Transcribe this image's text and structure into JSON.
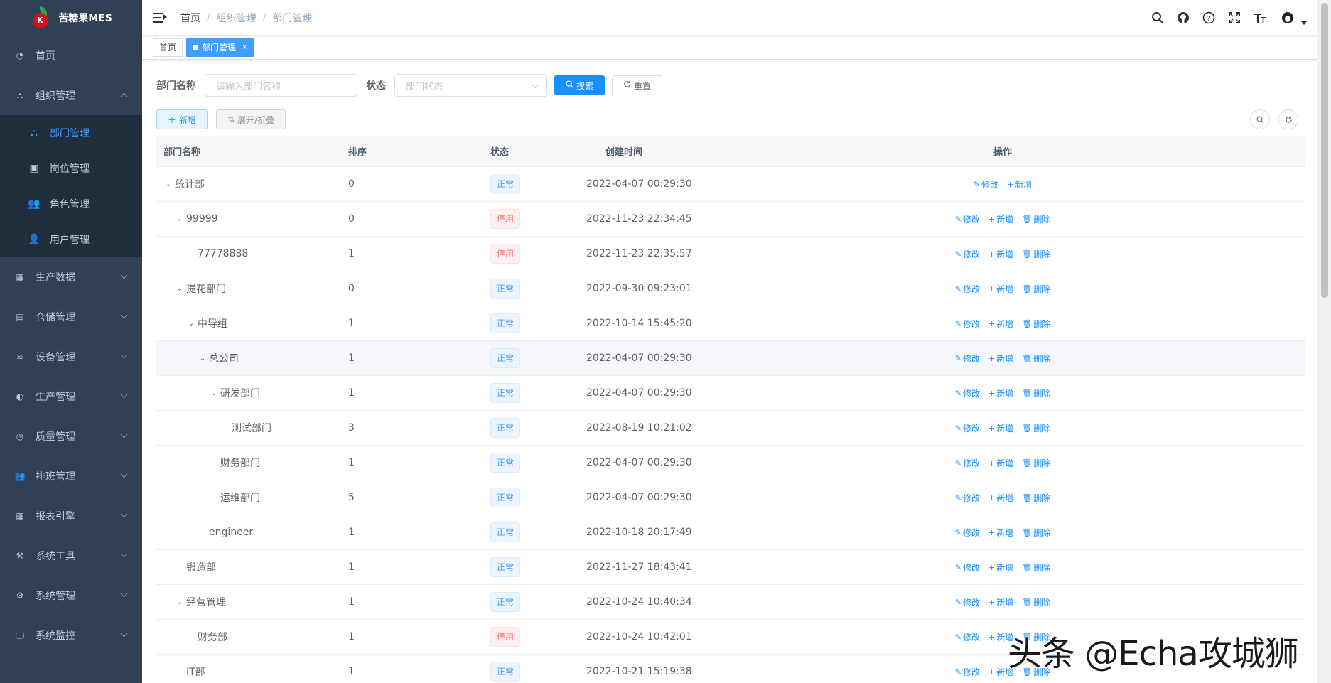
{
  "app": {
    "title": "苦糖果MES"
  },
  "sidebar": {
    "top_items": [
      {
        "label": "首页",
        "icon": "dashboard-icon"
      },
      {
        "label": "组织管理",
        "icon": "tree-icon",
        "expanded": true
      }
    ],
    "sub_items": [
      {
        "label": "部门管理",
        "icon": "tree-icon",
        "active": true
      },
      {
        "label": "岗位管理",
        "icon": "post-icon"
      },
      {
        "label": "角色管理",
        "icon": "peoples-icon"
      },
      {
        "label": "用户管理",
        "icon": "user-icon"
      }
    ],
    "bottom_items": [
      {
        "label": "生产数据",
        "icon": "table-icon"
      },
      {
        "label": "仓储管理",
        "icon": "storage-icon"
      },
      {
        "label": "设备管理",
        "icon": "layers-icon"
      },
      {
        "label": "生产管理",
        "icon": "toggle-icon"
      },
      {
        "label": "质量管理",
        "icon": "time-icon"
      },
      {
        "label": "排班管理",
        "icon": "peoples-icon"
      },
      {
        "label": "报表引擎",
        "icon": "grid-icon"
      },
      {
        "label": "系统工具",
        "icon": "tool-icon"
      },
      {
        "label": "系统管理",
        "icon": "gear-icon"
      },
      {
        "label": "系统监控",
        "icon": "monitor-icon"
      }
    ]
  },
  "navbar": {
    "breadcrumb": [
      "首页",
      "组织管理",
      "部门管理"
    ]
  },
  "tags": {
    "home": "首页",
    "active": "部门管理",
    "close": "×"
  },
  "search": {
    "name_label": "部门名称",
    "name_placeholder": "请输入部门名称",
    "status_label": "状态",
    "status_placeholder": "部门状态",
    "search_btn": "搜索",
    "reset_btn": "重置"
  },
  "toolbar": {
    "add_btn": "新增",
    "expand_btn": "展开/折叠"
  },
  "table": {
    "headers": [
      "部门名称",
      "排序",
      "状态",
      "创建时间",
      "操作"
    ],
    "op_edit": "修改",
    "op_add": "新增",
    "op_delete": "删除",
    "rows": [
      {
        "name": "统计部",
        "level": 0,
        "toggle": true,
        "sort": "0",
        "status": "正常",
        "status_type": "normal",
        "time": "2022-04-07 00:29:30",
        "delete": false
      },
      {
        "name": "99999",
        "level": 1,
        "toggle": true,
        "sort": "0",
        "status": "停用",
        "status_type": "danger",
        "time": "2022-11-23 22:34:45",
        "delete": true
      },
      {
        "name": "77778888",
        "level": 2,
        "toggle": false,
        "sort": "1",
        "status": "停用",
        "status_type": "danger",
        "time": "2022-11-23 22:35:57",
        "delete": true
      },
      {
        "name": "提花部门",
        "level": 1,
        "toggle": true,
        "sort": "0",
        "status": "正常",
        "status_type": "normal",
        "time": "2022-09-30 09:23:01",
        "delete": true
      },
      {
        "name": "中导组",
        "level": 2,
        "toggle": true,
        "sort": "1",
        "status": "正常",
        "status_type": "normal",
        "time": "2022-10-14 15:45:20",
        "delete": true
      },
      {
        "name": "总公司",
        "level": 3,
        "toggle": true,
        "sort": "1",
        "status": "正常",
        "status_type": "normal",
        "time": "2022-04-07 00:29:30",
        "delete": true,
        "hover": true
      },
      {
        "name": "研发部门",
        "level": 4,
        "toggle": true,
        "sort": "1",
        "status": "正常",
        "status_type": "normal",
        "time": "2022-04-07 00:29:30",
        "delete": true
      },
      {
        "name": "测试部门",
        "level": 5,
        "toggle": false,
        "sort": "3",
        "status": "正常",
        "status_type": "normal",
        "time": "2022-08-19 10:21:02",
        "delete": true
      },
      {
        "name": "财务部门",
        "level": 4,
        "toggle": false,
        "sort": "1",
        "status": "正常",
        "status_type": "normal",
        "time": "2022-04-07 00:29:30",
        "delete": true
      },
      {
        "name": "运维部门",
        "level": 4,
        "toggle": false,
        "sort": "5",
        "status": "正常",
        "status_type": "normal",
        "time": "2022-04-07 00:29:30",
        "delete": true
      },
      {
        "name": "engineer",
        "level": 3,
        "toggle": false,
        "sort": "1",
        "status": "正常",
        "status_type": "normal",
        "time": "2022-10-18 20:17:49",
        "delete": true
      },
      {
        "name": "锻造部",
        "level": 1,
        "toggle": false,
        "sort": "1",
        "status": "正常",
        "status_type": "normal",
        "time": "2022-11-27 18:43:41",
        "delete": true
      },
      {
        "name": "经营管理",
        "level": 1,
        "toggle": true,
        "sort": "1",
        "status": "正常",
        "status_type": "normal",
        "time": "2022-10-24 10:40:34",
        "delete": true
      },
      {
        "name": "财务部",
        "level": 2,
        "toggle": false,
        "sort": "1",
        "status": "停用",
        "status_type": "danger",
        "time": "2022-10-24 10:42:01",
        "delete": true
      },
      {
        "name": "IT部",
        "level": 1,
        "toggle": false,
        "sort": "1",
        "status": "正常",
        "status_type": "normal",
        "time": "2022-10-21 15:19:38",
        "delete": true
      }
    ]
  },
  "watermark": "头条 @Echa攻城狮",
  "colors": {
    "sidebar_bg": "#304156",
    "submenu_bg": "#1f2d3d",
    "primary": "#1890ff",
    "active_menu": "#409eff",
    "danger": "#f56c6c"
  }
}
